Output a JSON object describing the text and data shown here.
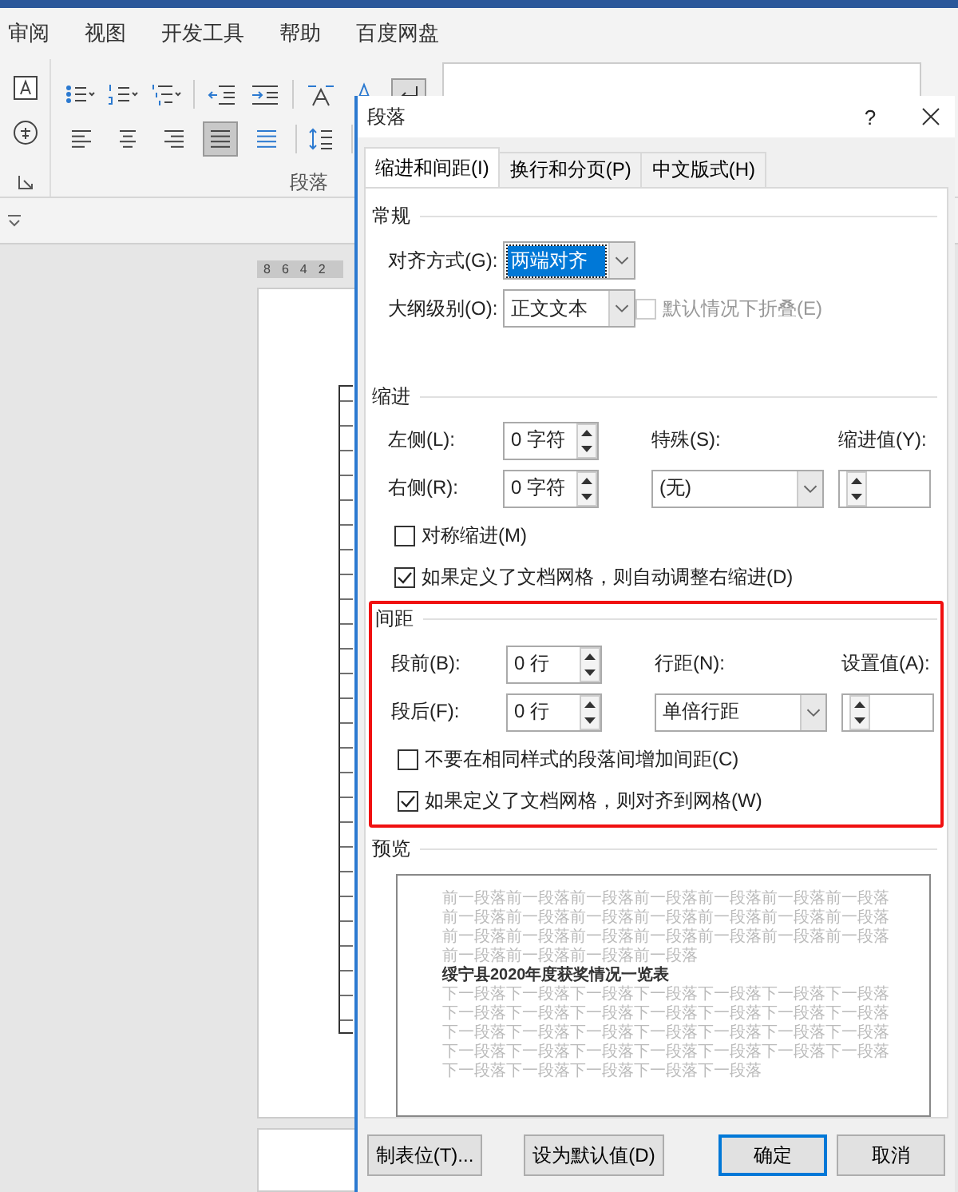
{
  "menu_tabs": [
    "审阅",
    "视图",
    "开发工具",
    "帮助",
    "百度网盘"
  ],
  "ribbon": {
    "group_label": "段落",
    "align_buttons": [
      {
        "kind": "left",
        "selected": false
      },
      {
        "kind": "center",
        "selected": false
      },
      {
        "kind": "right",
        "selected": false
      },
      {
        "kind": "justify",
        "selected": true
      },
      {
        "kind": "distributed",
        "selected": false
      }
    ]
  },
  "ruler": [
    "8",
    "6",
    "4",
    "2"
  ],
  "dialog": {
    "title": "段落",
    "help": "?",
    "tabs": [
      {
        "label": "缩进和间距(I)",
        "selected": true
      },
      {
        "label": "换行和分页(P)",
        "selected": false
      },
      {
        "label": "中文版式(H)",
        "selected": false
      }
    ],
    "general": {
      "heading": "常规",
      "alignment": {
        "label": "对齐方式(G):",
        "value": "两端对齐",
        "focused": true
      },
      "outline": {
        "label": "大纲级别(O):",
        "value": "正文文本",
        "focused": false
      },
      "collapse": {
        "label": "默认情况下折叠(E)",
        "checked": false,
        "disabled": true
      }
    },
    "indent": {
      "heading": "缩进",
      "left": {
        "label": "左侧(L):",
        "value": "0 字符"
      },
      "right": {
        "label": "右侧(R):",
        "value": "0 字符"
      },
      "special": {
        "label": "特殊(S):",
        "value": "(无)"
      },
      "by": {
        "label": "缩进值(Y):"
      },
      "checkboxes": [
        {
          "label": "对称缩进(M)",
          "checked": false
        },
        {
          "label": "如果定义了文档网格，则自动调整右缩进(D)",
          "checked": true
        }
      ]
    },
    "spacing": {
      "heading": "间距",
      "highlighted": true,
      "before": {
        "label": "段前(B):",
        "value": "0 行"
      },
      "after": {
        "label": "段后(F):",
        "value": "0 行"
      },
      "line_spacing": {
        "label": "行距(N):",
        "value": "单倍行距"
      },
      "at": {
        "label": "设置值(A):"
      },
      "checkboxes": [
        {
          "label": "不要在相同样式的段落间增加间距(C)",
          "checked": false
        },
        {
          "label": "如果定义了文档网格，则对齐到网格(W)",
          "checked": true
        }
      ]
    },
    "preview": {
      "heading": "预览",
      "previous": "前一段落前一段落前一段落前一段落前一段落前一段落前一段落前一段落前一段落前一段落前一段落前一段落前一段落前一段落前一段落前一段落前一段落前一段落前一段落前一段落前一段落前一段落前一段落前一段落前一段落",
      "sample": "绥宁县2020年度获奖情况一览表",
      "next": "下一段落下一段落下一段落下一段落下一段落下一段落下一段落下一段落下一段落下一段落下一段落下一段落下一段落下一段落下一段落下一段落下一段落下一段落下一段落下一段落下一段落下一段落下一段落下一段落下一段落下一段落下一段落下一段落下一段落下一段落下一段落下一段落下一段落"
    },
    "buttons": [
      {
        "label": "制表位(T)...",
        "default": false
      },
      {
        "label": "设为默认值(D)",
        "default": false
      },
      {
        "label": "确定",
        "default": true
      },
      {
        "label": "取消",
        "default": false
      }
    ]
  }
}
